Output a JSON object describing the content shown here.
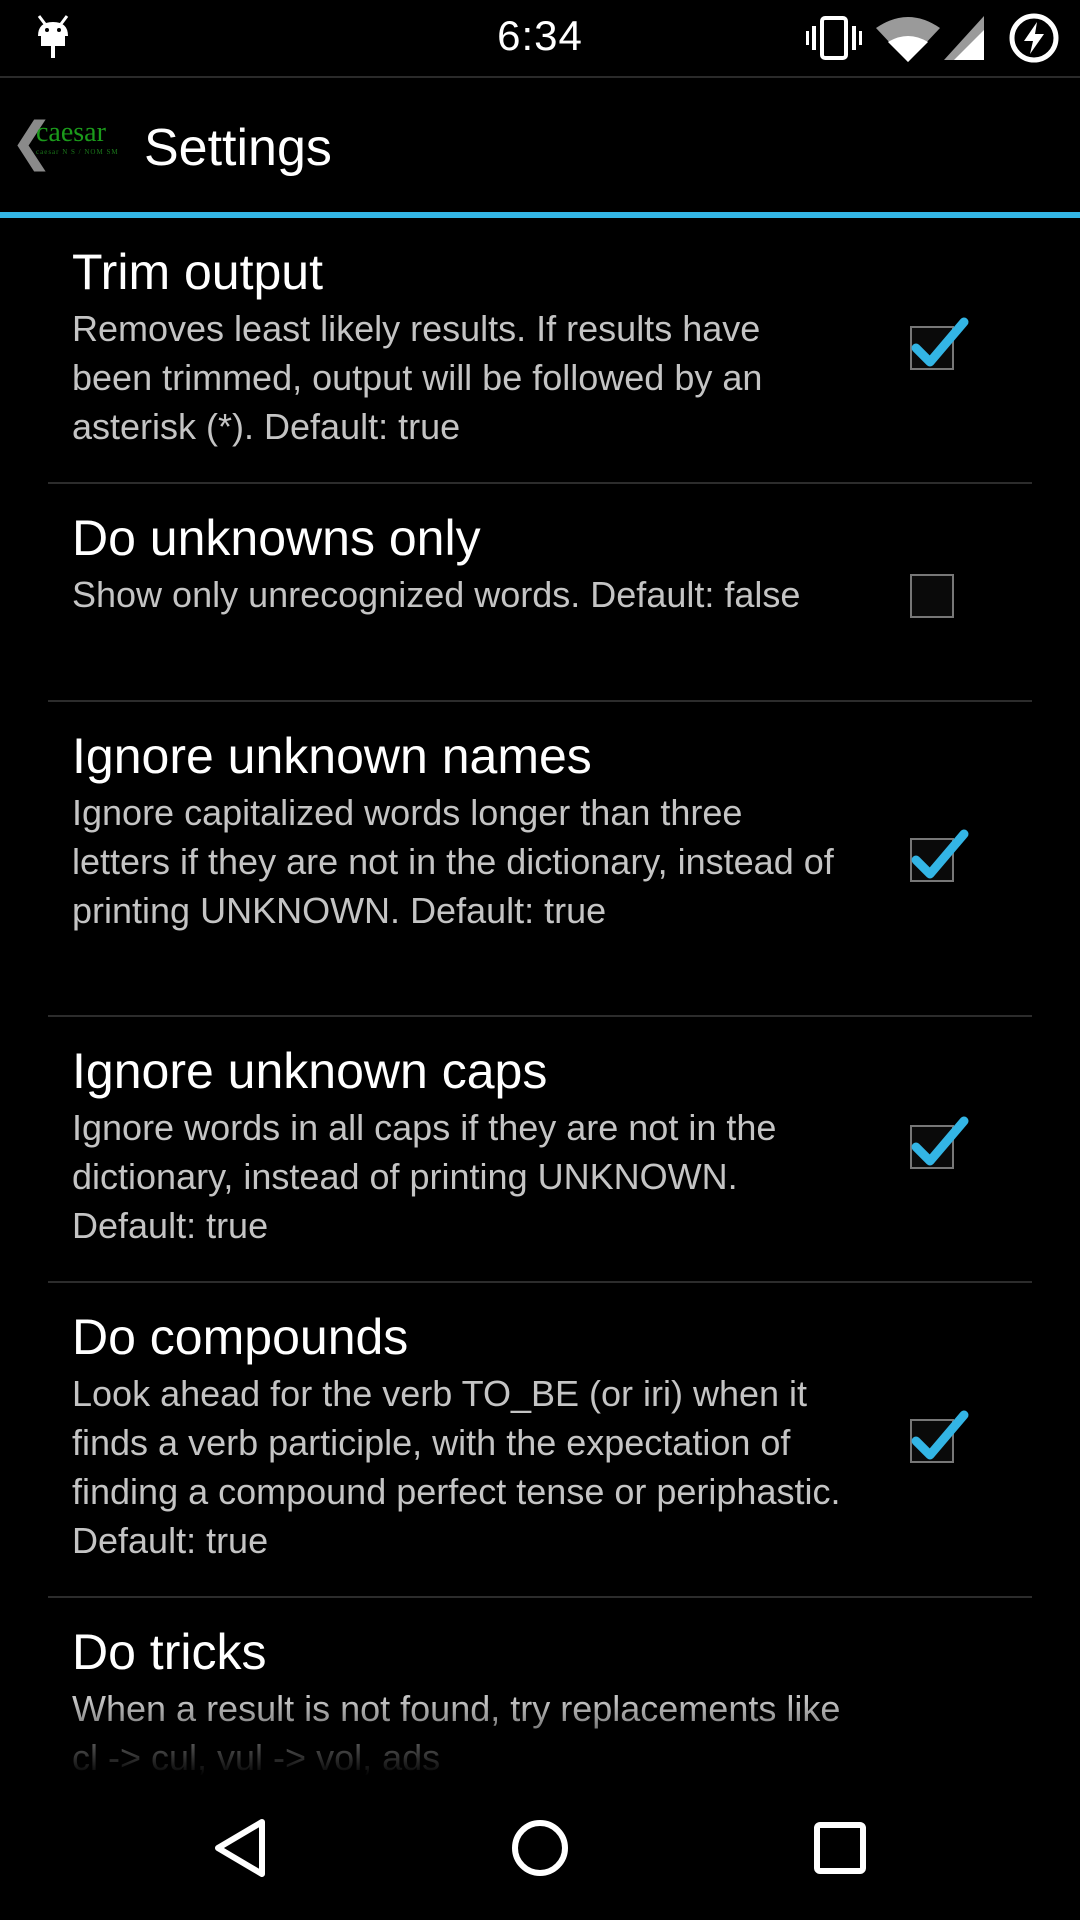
{
  "status_bar": {
    "time": "6:34",
    "icons": [
      "android-debug-icon",
      "vibrate-icon",
      "wifi-icon",
      "cell-signal-icon",
      "battery-charging-icon"
    ]
  },
  "action_bar": {
    "logo_text": "caesar",
    "logo_subtext": "caesar N S / NOM SM",
    "title": "Settings",
    "accent_color": "#33b5e5"
  },
  "preferences": [
    {
      "title": "Trim output",
      "summary": "Removes least likely results. If results have been trimmed, output will be followed by an asterisk (*). Default: true",
      "checked": true
    },
    {
      "title": "Do unknowns only",
      "summary": "Show only unrecognized words. Default: false",
      "checked": false
    },
    {
      "title": "Ignore unknown names",
      "summary": "Ignore capitalized words longer than three letters if they are not in the dictionary, instead of printing UNKNOWN. Default: true",
      "checked": true
    },
    {
      "title": "Ignore unknown caps",
      "summary": "Ignore words in all caps if they are not in the dictionary, instead of printing UNKNOWN. Default: true",
      "checked": true
    },
    {
      "title": "Do compounds",
      "summary": "Look ahead for the verb TO_BE (or iri) when it finds a verb participle, with the expectation of finding a compound perfect tense or periphastic. Default: true",
      "checked": true
    },
    {
      "title": "Do tricks",
      "summary": "When a result is not found, try replacements like cl -> cul, vul -> vol, ads",
      "checked": null
    }
  ],
  "nav_bar": {
    "buttons": [
      "back-icon",
      "home-icon",
      "recents-icon"
    ]
  }
}
